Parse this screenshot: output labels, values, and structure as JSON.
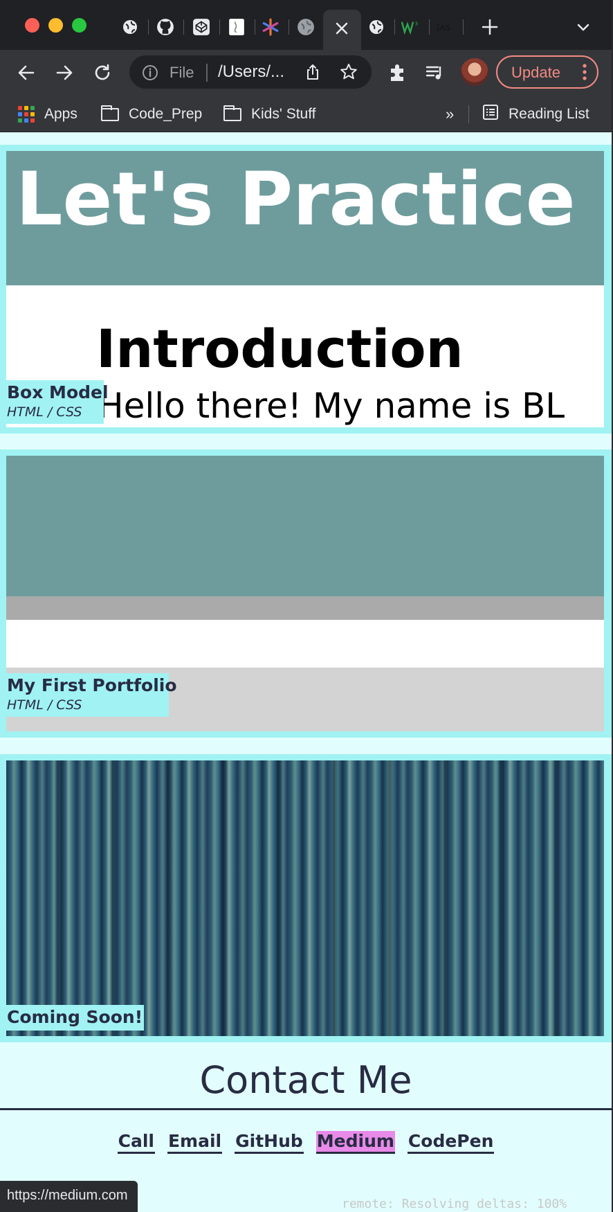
{
  "browser": {
    "omnibox": {
      "scheme_label": "File",
      "url": "/Users/..."
    },
    "update_label": "Update",
    "bookmarks": [
      "Apps",
      "Code_Prep",
      "Kids' Stuff"
    ],
    "overflow_label": "»",
    "reading_list_label": "Reading List",
    "tab_icons": [
      "globe-icon",
      "github-icon",
      "codepen-icon",
      "doc-icon",
      "asterisk-icon",
      "globe-icon",
      "close-icon",
      "globe-icon",
      "w3-icon",
      "ias-icon"
    ],
    "accent_colors": {
      "update": "#f28b82",
      "tab_bg": "#202124",
      "toolbar_bg": "#35363a"
    }
  },
  "projects": [
    {
      "title": "Box Model",
      "tech": "HTML / CSS",
      "preview": {
        "header_text": "Let's Practice",
        "heading": "Introduction",
        "body_text": "Hello there! My name is BL"
      }
    },
    {
      "title": "My First Portfolio",
      "tech": "HTML / CSS"
    },
    {
      "title": "Coming Soon!"
    }
  ],
  "contact": {
    "title": "Contact Me",
    "links": [
      "Call",
      "Email",
      "GitHub",
      "Medium",
      "CodePen"
    ],
    "hovered_link": "Medium"
  },
  "status_bar": {
    "url": "https://medium.com"
  },
  "terminal_snippet": "remote: Resolving deltas: 100%",
  "colors": {
    "page_bg": "#e2fdfd",
    "card_frame": "#a1f2f2",
    "teal": "#6e9c9d",
    "text_dark": "#272c43",
    "hover_highlight": "#e88ae8"
  }
}
